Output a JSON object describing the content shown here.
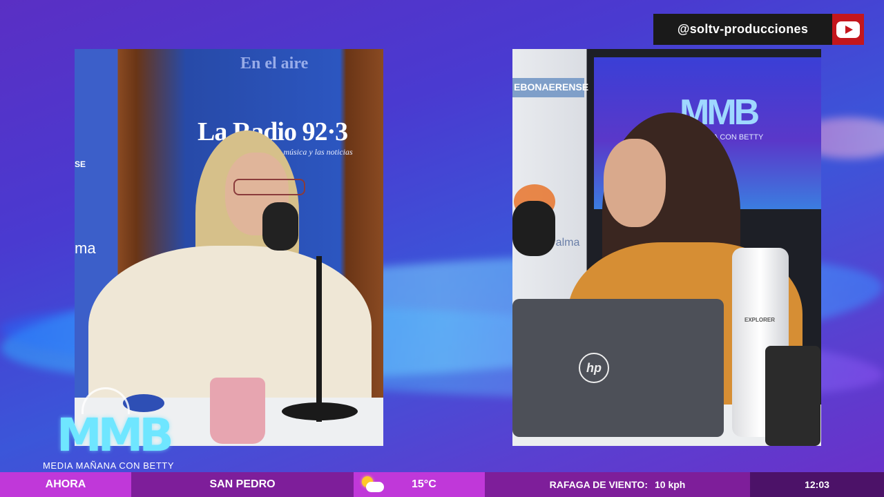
{
  "channel": {
    "handle": "@soltv-producciones",
    "platform_icon": "youtube-icon"
  },
  "studio_left": {
    "banner": "La Radio 92·3",
    "banner_sub": "la música y las noticias",
    "banner_top": "En el aire",
    "side_text": "SE",
    "side_text2": "ma"
  },
  "studio_right": {
    "sign": "EBONAERENSE",
    "screen_logo": "MMB",
    "screen_text": "AÑANA CON BETTY",
    "wall_text": "Palma",
    "laptop_brand": "hp",
    "bottle_label": "EXPLORER"
  },
  "brand": {
    "logo": "MMB",
    "subtitle": "MEDIA MAÑANA CON BETTY"
  },
  "ticker": {
    "now_label": "AHORA",
    "city": "SAN PEDRO",
    "temperature": "15°C",
    "weather_icon": "partly-cloudy-icon",
    "wind_label": "RAFAGA DE VIENTO:",
    "wind_value": "10 kph",
    "time": "12:03"
  },
  "colors": {
    "ticker_pink": "#c038d9",
    "ticker_purple": "#7e1e9a",
    "ticker_dark": "#4c1268",
    "youtube_red": "#c4161c"
  }
}
